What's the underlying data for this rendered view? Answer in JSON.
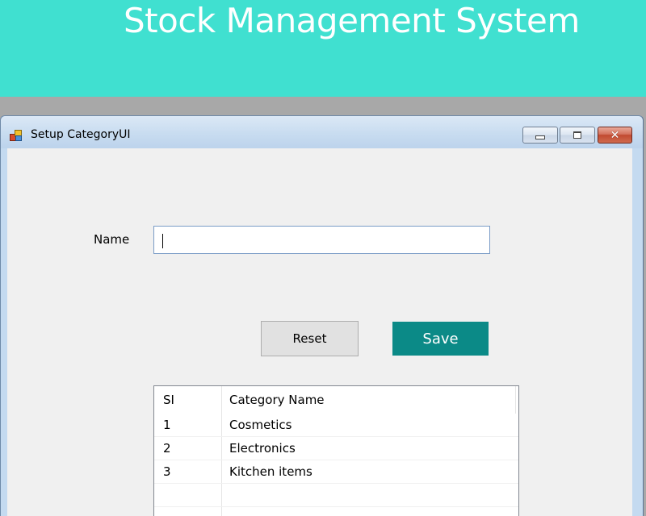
{
  "banner": {
    "title": "Stock Management System",
    "background": "#40e0d0"
  },
  "window": {
    "title": "Setup CategoryUI",
    "icon": "app-window-icon",
    "controls": {
      "minimize": "minimize-icon",
      "maximize": "maximize-icon",
      "close": "close-icon"
    }
  },
  "form": {
    "name_label": "Name",
    "name_value": "",
    "name_placeholder": "",
    "reset_label": "Reset",
    "save_label": "Save",
    "save_color": "#0b8a87"
  },
  "table": {
    "columns": [
      "SI",
      "Category Name"
    ],
    "rows": [
      {
        "si": "1",
        "name": "Cosmetics"
      },
      {
        "si": "2",
        "name": "Electronics"
      },
      {
        "si": "3",
        "name": "Kitchen items"
      }
    ]
  }
}
